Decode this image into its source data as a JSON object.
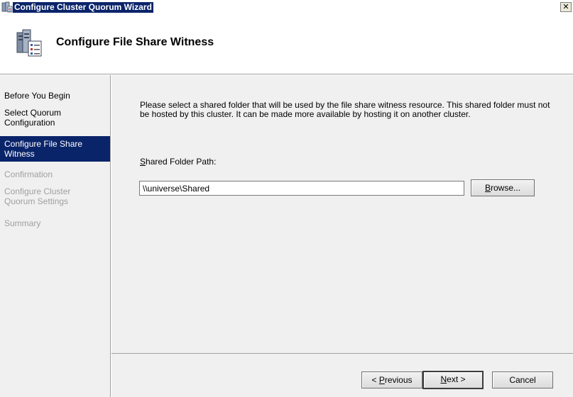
{
  "window": {
    "title": "Configure Cluster Quorum Wizard",
    "close_glyph": "✕"
  },
  "header": {
    "title": "Configure File Share Witness",
    "icon": "cluster-server-icon"
  },
  "nav": {
    "items": [
      {
        "label": "Before You Begin",
        "state": "normal"
      },
      {
        "label": "Select Quorum Configuration",
        "state": "normal"
      },
      {
        "label": "Configure File Share Witness",
        "state": "active"
      },
      {
        "label": "Confirmation",
        "state": "disabled"
      },
      {
        "label": "Configure Cluster Quorum Settings",
        "state": "disabled"
      },
      {
        "label": "Summary",
        "state": "disabled"
      }
    ]
  },
  "content": {
    "description": "Please select a shared folder that will be used by the file share witness resource.  This shared folder must not be hosted by this cluster.  It can be made more available by hosting it on another cluster.",
    "field_label_access": "S",
    "field_label_rest": "hared Folder Path:",
    "path_value": "\\\\universe\\Shared",
    "browse_access": "B",
    "browse_rest": "rowse..."
  },
  "footer": {
    "prev_prefix": "< ",
    "prev_access": "P",
    "prev_rest": "revious",
    "next_access": "N",
    "next_rest": "ext >",
    "cancel_label": "Cancel"
  },
  "colors": {
    "active_nav": "#0a246a",
    "panel_bg": "#f0f0f0",
    "disabled_text": "#a0a0a0"
  }
}
